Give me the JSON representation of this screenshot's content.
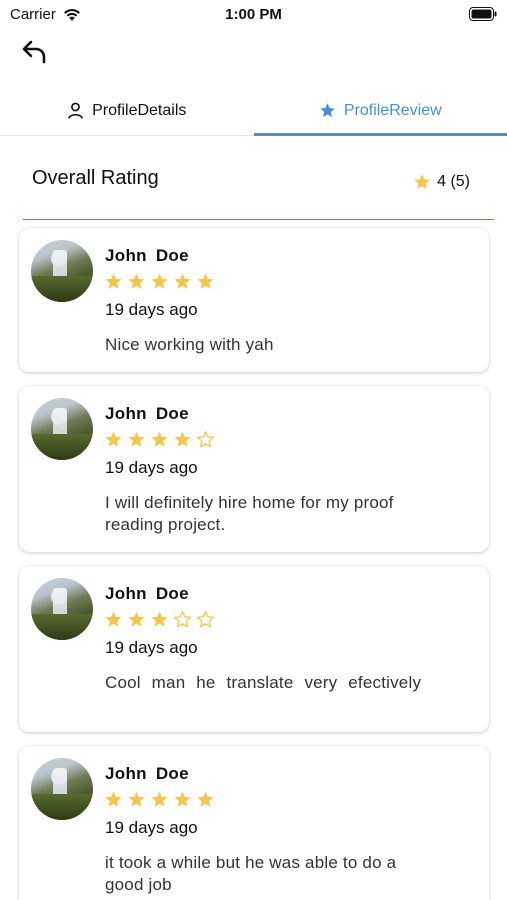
{
  "status_bar": {
    "carrier": "Carrier",
    "time": "1:00 PM"
  },
  "header": {
    "back_icon": "back-arrow-icon"
  },
  "tabs": [
    {
      "label": "ProfileDetails",
      "icon": "person-icon",
      "active": false
    },
    {
      "label": "ProfileReview",
      "icon": "star-icon",
      "active": true
    }
  ],
  "overall_rating": {
    "title": "Overall Rating",
    "value": "4 (5)"
  },
  "colors": {
    "accent": "#4a8fd6",
    "star": "#f5c64a"
  },
  "reviews": [
    {
      "name": "John  Doe",
      "rating": 5,
      "date": "19 days ago",
      "text": "Nice working with yah"
    },
    {
      "name": "John  Doe",
      "rating": 4,
      "date": "19 days ago",
      "text": "I will definitely hire home for my proof reading project."
    },
    {
      "name": "John  Doe",
      "rating": 3,
      "date": "19 days ago",
      "text": "Cool man he translate very efectively"
    },
    {
      "name": "John  Doe",
      "rating": 5,
      "date": "19 days ago",
      "text": "it took a while but he was able to do a good job"
    }
  ]
}
